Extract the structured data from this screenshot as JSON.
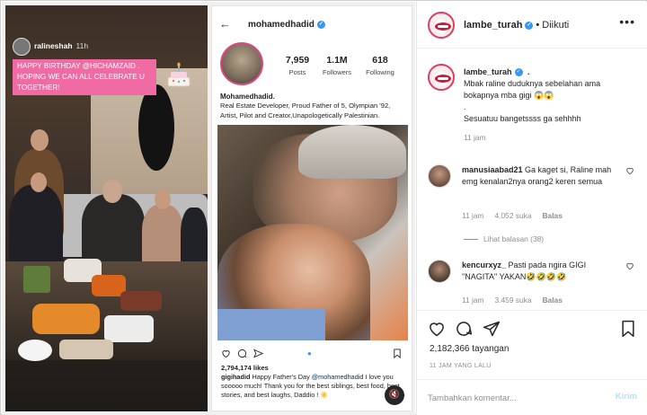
{
  "story": {
    "username": "ralineshah",
    "time": "11h",
    "caption": "HAPPY BIRTHDAY @HICHAMZAID . HOPING WE CAN ALL CELEBRATE U TOGETHER!"
  },
  "igpost": {
    "handle": "mohamedhadid",
    "stats": [
      {
        "value": "7,959",
        "label": "Posts"
      },
      {
        "value": "1.1M",
        "label": "Followers"
      },
      {
        "value": "618",
        "label": "Following"
      }
    ],
    "display_name": "Mohamedhadid.",
    "bio": "Real Estate Developer, Proud Father of 5, Olympian '92, Artist, Pilot  and Creator,Unapologetically Palestinian.",
    "likes": "2,794,174 likes",
    "caption_user": "gigihadid",
    "caption_pre": "Happy Father's Day ",
    "caption_mention": "@mohamedhadid",
    "caption_post": " I love you sooooo much! Thank you for the best siblings, best food, best stories, and best laughs, Daddio ! ☀️"
  },
  "header": {
    "username": "lambe_turah",
    "follow_status": "Diikuti"
  },
  "post_caption": {
    "username": "lambe_turah",
    "line1": "Mbak raline duduknya sebelahan ama bokapnya mba gigi 😱😱",
    "line2": ".",
    "line3": "Sesuatuu bangetssss ga sehhhh",
    "time": "11 jam"
  },
  "comments": [
    {
      "username": "manusiaabad21",
      "text": "Ga kaget si, Raline mah emg kenalan2nya orang2 keren semua",
      "time": "11 jam",
      "likes": "4.052 suka",
      "reply": "Balas"
    },
    {
      "username": "kencurxyz_",
      "text": "Pasti pada ngira GIGI \"NAGITA\" YAKAN🤣🤣🤣🤣",
      "time": "11 jam",
      "likes": "3.459 suka",
      "reply": "Balas"
    }
  ],
  "view_replies": "Lihat balasan (38)",
  "views": "2,182,366 tayangan",
  "date": "11 JAM YANG LALU",
  "add_comment": {
    "placeholder": "Tambahkan komentar...",
    "send": "Kirim"
  },
  "colors": {
    "story_caption_bg": "#f06aa4",
    "verified_blue": "#3897f0",
    "brand_ring": "#e33a62",
    "send_disabled": "#b2dffc"
  }
}
